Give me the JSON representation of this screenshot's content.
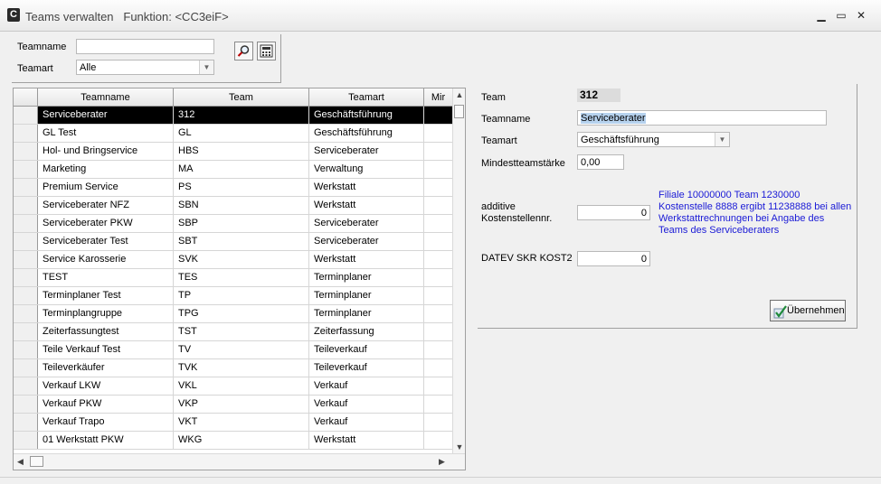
{
  "window": {
    "title": "Teams verwalten   Funktion: <CC3eiF>",
    "app_icon": "C",
    "minimize": "▁",
    "maximize": "▭",
    "close": "✕"
  },
  "filter": {
    "teamname_label": "Teamname",
    "teamname_value": "",
    "teamart_label": "Teamart",
    "teamart_value": "Alle"
  },
  "grid": {
    "columns": [
      "",
      "Teamname",
      "Team",
      "Teamart",
      "Mir"
    ],
    "rows": [
      {
        "teamname": "Serviceberater",
        "team": "312",
        "teamart": "Geschäftsführung",
        "selected": true
      },
      {
        "teamname": "GL Test",
        "team": "GL",
        "teamart": "Geschäftsführung"
      },
      {
        "teamname": "Hol- und Bringservice",
        "team": "HBS",
        "teamart": "Serviceberater"
      },
      {
        "teamname": "Marketing",
        "team": "MA",
        "teamart": "Verwaltung"
      },
      {
        "teamname": "Premium Service",
        "team": "PS",
        "teamart": "Werkstatt"
      },
      {
        "teamname": "Serviceberater NFZ",
        "team": "SBN",
        "teamart": "Werkstatt"
      },
      {
        "teamname": "Serviceberater PKW",
        "team": "SBP",
        "teamart": "Serviceberater"
      },
      {
        "teamname": "Serviceberater Test",
        "team": "SBT",
        "teamart": "Serviceberater"
      },
      {
        "teamname": "Service Karosserie",
        "team": "SVK",
        "teamart": "Werkstatt"
      },
      {
        "teamname": "TEST",
        "team": "TES",
        "teamart": "Terminplaner"
      },
      {
        "teamname": "Terminplaner Test",
        "team": "TP",
        "teamart": "Terminplaner"
      },
      {
        "teamname": "Terminplangruppe",
        "team": "TPG",
        "teamart": "Terminplaner"
      },
      {
        "teamname": "Zeiterfassungtest",
        "team": "TST",
        "teamart": "Zeiterfassung"
      },
      {
        "teamname": "Teile Verkauf Test",
        "team": "TV",
        "teamart": "Teileverkauf"
      },
      {
        "teamname": "Teileverkäufer",
        "team": "TVK",
        "teamart": "Teileverkauf"
      },
      {
        "teamname": "Verkauf LKW",
        "team": "VKL",
        "teamart": "Verkauf"
      },
      {
        "teamname": "Verkauf PKW",
        "team": "VKP",
        "teamart": "Verkauf"
      },
      {
        "teamname": "Verkauf Trapo",
        "team": "VKT",
        "teamart": "Verkauf"
      },
      {
        "teamname": "01 Werkstatt PKW",
        "team": "WKG",
        "teamart": "Werkstatt"
      }
    ]
  },
  "detail": {
    "team_label": "Team",
    "team_value": "312",
    "teamname_label": "Teamname",
    "teamname_value": "Serviceberater",
    "teamart_label": "Teamart",
    "teamart_value": "Geschäftsführung",
    "mindest_label": "Mindestteamstärke",
    "mindest_value": "0,00",
    "additive_label_1": "additive",
    "additive_label_2": "Kostenstellennr.",
    "additive_value": "0",
    "info_text": "Filiale 10000000 Team 1230000 Kostenstelle 8888 ergibt 11238888 bei allen Werkstattrechnungen bei Angabe des Teams des Serviceberaters",
    "datev_label": "DATEV SKR KOST2",
    "datev_value": "0",
    "apply_label": "Übernehmen"
  },
  "icons": {
    "search": "search-icon",
    "calculator": "calculator-icon",
    "checkmark": "checkmark-icon"
  }
}
